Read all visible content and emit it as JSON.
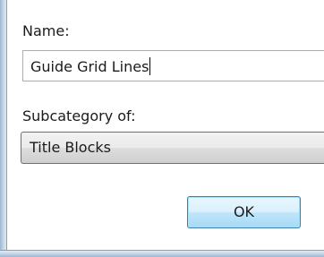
{
  "dialog": {
    "name_label": "Name:",
    "name_value": "Guide Grid Lines",
    "subcategory_label": "Subcategory of:",
    "subcategory_value": "Title Blocks",
    "ok_label": "OK"
  }
}
